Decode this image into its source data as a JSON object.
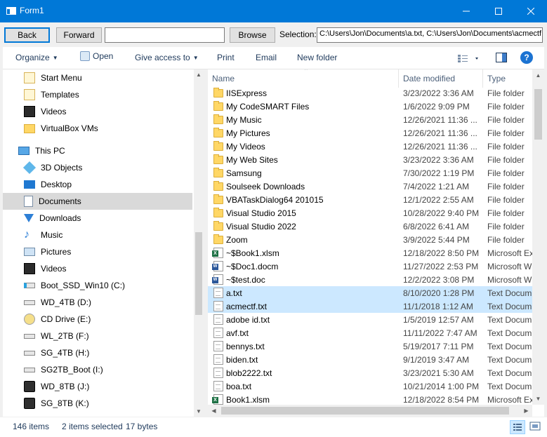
{
  "window": {
    "title": "Form1"
  },
  "toolbar": {
    "back": "Back",
    "forward": "Forward",
    "text_value": "",
    "browse": "Browse",
    "selection_label": "Selection:",
    "selection_value": "C:\\Users\\Jon\\Documents\\a.txt, C:\\Users\\Jon\\Documents\\acmectf.txt"
  },
  "commands": {
    "organize": "Organize",
    "open": "Open",
    "give_access": "Give access to",
    "print": "Print",
    "email": "Email",
    "new_folder": "New folder"
  },
  "nav": {
    "items": [
      {
        "label": "Start Menu",
        "icon": "shortcut-folder-icon"
      },
      {
        "label": "Templates",
        "icon": "shortcut-folder-icon"
      },
      {
        "label": "Videos",
        "icon": "videos-icon"
      },
      {
        "label": "VirtualBox VMs",
        "icon": "folder-icon"
      },
      {
        "label": "This PC",
        "icon": "computer-icon"
      },
      {
        "label": "3D Objects",
        "icon": "cube-icon"
      },
      {
        "label": "Desktop",
        "icon": "desktop-icon"
      },
      {
        "label": "Documents",
        "icon": "documents-icon"
      },
      {
        "label": "Downloads",
        "icon": "download-icon"
      },
      {
        "label": "Music",
        "icon": "music-icon"
      },
      {
        "label": "Pictures",
        "icon": "pictures-icon"
      },
      {
        "label": "Videos",
        "icon": "videos-icon"
      },
      {
        "label": "Boot_SSD_Win10 (C:)",
        "icon": "windows-drive-icon"
      },
      {
        "label": "WD_4TB (D:)",
        "icon": "drive-icon"
      },
      {
        "label": "CD Drive (E:)",
        "icon": "cd-drive-icon"
      },
      {
        "label": "WL_2TB (F:)",
        "icon": "drive-icon"
      },
      {
        "label": "SG_4TB (H:)",
        "icon": "drive-icon"
      },
      {
        "label": "SG2TB_Boot (I:)",
        "icon": "drive-icon"
      },
      {
        "label": "WD_8TB (J:)",
        "icon": "usb-drive-icon"
      },
      {
        "label": "SG_8TB (K:)",
        "icon": "usb-drive-icon"
      }
    ]
  },
  "columns": {
    "name": "Name",
    "date": "Date modified",
    "type": "Type"
  },
  "files": [
    {
      "name": "IISExpress",
      "date": "3/23/2022 3:36 AM",
      "type": "File folder",
      "icon": "folder"
    },
    {
      "name": "My CodeSMART Files",
      "date": "1/6/2022 9:09 PM",
      "type": "File folder",
      "icon": "folder"
    },
    {
      "name": "My Music",
      "date": "12/26/2021 11:36 ...",
      "type": "File folder",
      "icon": "music"
    },
    {
      "name": "My Pictures",
      "date": "12/26/2021 11:36 ...",
      "type": "File folder",
      "icon": "pictures"
    },
    {
      "name": "My Videos",
      "date": "12/26/2021 11:36 ...",
      "type": "File folder",
      "icon": "videos"
    },
    {
      "name": "My Web Sites",
      "date": "3/23/2022 3:36 AM",
      "type": "File folder",
      "icon": "folder"
    },
    {
      "name": "Samsung",
      "date": "7/30/2022 1:19 PM",
      "type": "File folder",
      "icon": "folder"
    },
    {
      "name": "Soulseek Downloads",
      "date": "7/4/2022 1:21 AM",
      "type": "File folder",
      "icon": "folder"
    },
    {
      "name": "VBATaskDialog64 201015",
      "date": "12/1/2022 2:55 AM",
      "type": "File folder",
      "icon": "folder"
    },
    {
      "name": "Visual Studio 2015",
      "date": "10/28/2022 9:40 PM",
      "type": "File folder",
      "icon": "folder"
    },
    {
      "name": "Visual Studio 2022",
      "date": "6/8/2022 6:41 AM",
      "type": "File folder",
      "icon": "folder"
    },
    {
      "name": "Zoom",
      "date": "3/9/2022 5:44 PM",
      "type": "File folder",
      "icon": "folder"
    },
    {
      "name": "~$Book1.xlsm",
      "date": "12/18/2022 8:50 PM",
      "type": "Microsoft Ex",
      "icon": "xls"
    },
    {
      "name": "~$Doc1.docm",
      "date": "11/27/2022 2:53 PM",
      "type": "Microsoft W",
      "icon": "doc"
    },
    {
      "name": "~$test.doc",
      "date": "12/2/2022 3:08 PM",
      "type": "Microsoft W",
      "icon": "doc"
    },
    {
      "name": "a.txt",
      "date": "8/10/2020 1:28 PM",
      "type": "Text Docum",
      "icon": "txt",
      "selected": true
    },
    {
      "name": "acmectf.txt",
      "date": "11/1/2018 1:12 AM",
      "type": "Text Docum",
      "icon": "txt",
      "selected": true
    },
    {
      "name": "adobe id.txt",
      "date": "1/5/2019 12:57 AM",
      "type": "Text Docum",
      "icon": "txt"
    },
    {
      "name": "avf.txt",
      "date": "11/11/2022 7:47 AM",
      "type": "Text Docum",
      "icon": "txt"
    },
    {
      "name": "bennys.txt",
      "date": "5/19/2017 7:11 PM",
      "type": "Text Docum",
      "icon": "txt"
    },
    {
      "name": "biden.txt",
      "date": "9/1/2019 3:47 AM",
      "type": "Text Docum",
      "icon": "txt"
    },
    {
      "name": "blob2222.txt",
      "date": "3/23/2021 5:30 AM",
      "type": "Text Docum",
      "icon": "txt"
    },
    {
      "name": "boa.txt",
      "date": "10/21/2014 1:00 PM",
      "type": "Text Docum",
      "icon": "txt"
    },
    {
      "name": "Book1.xlsm",
      "date": "12/18/2022 8:54 PM",
      "type": "Microsoft Ex",
      "icon": "xls"
    }
  ],
  "status": {
    "items": "146 items",
    "selected": "2 items selected",
    "size": "17 bytes"
  },
  "colors": {
    "titlebar": "#0078d7",
    "selection": "#cce8ff",
    "nav_selected": "#d9d9d9"
  }
}
